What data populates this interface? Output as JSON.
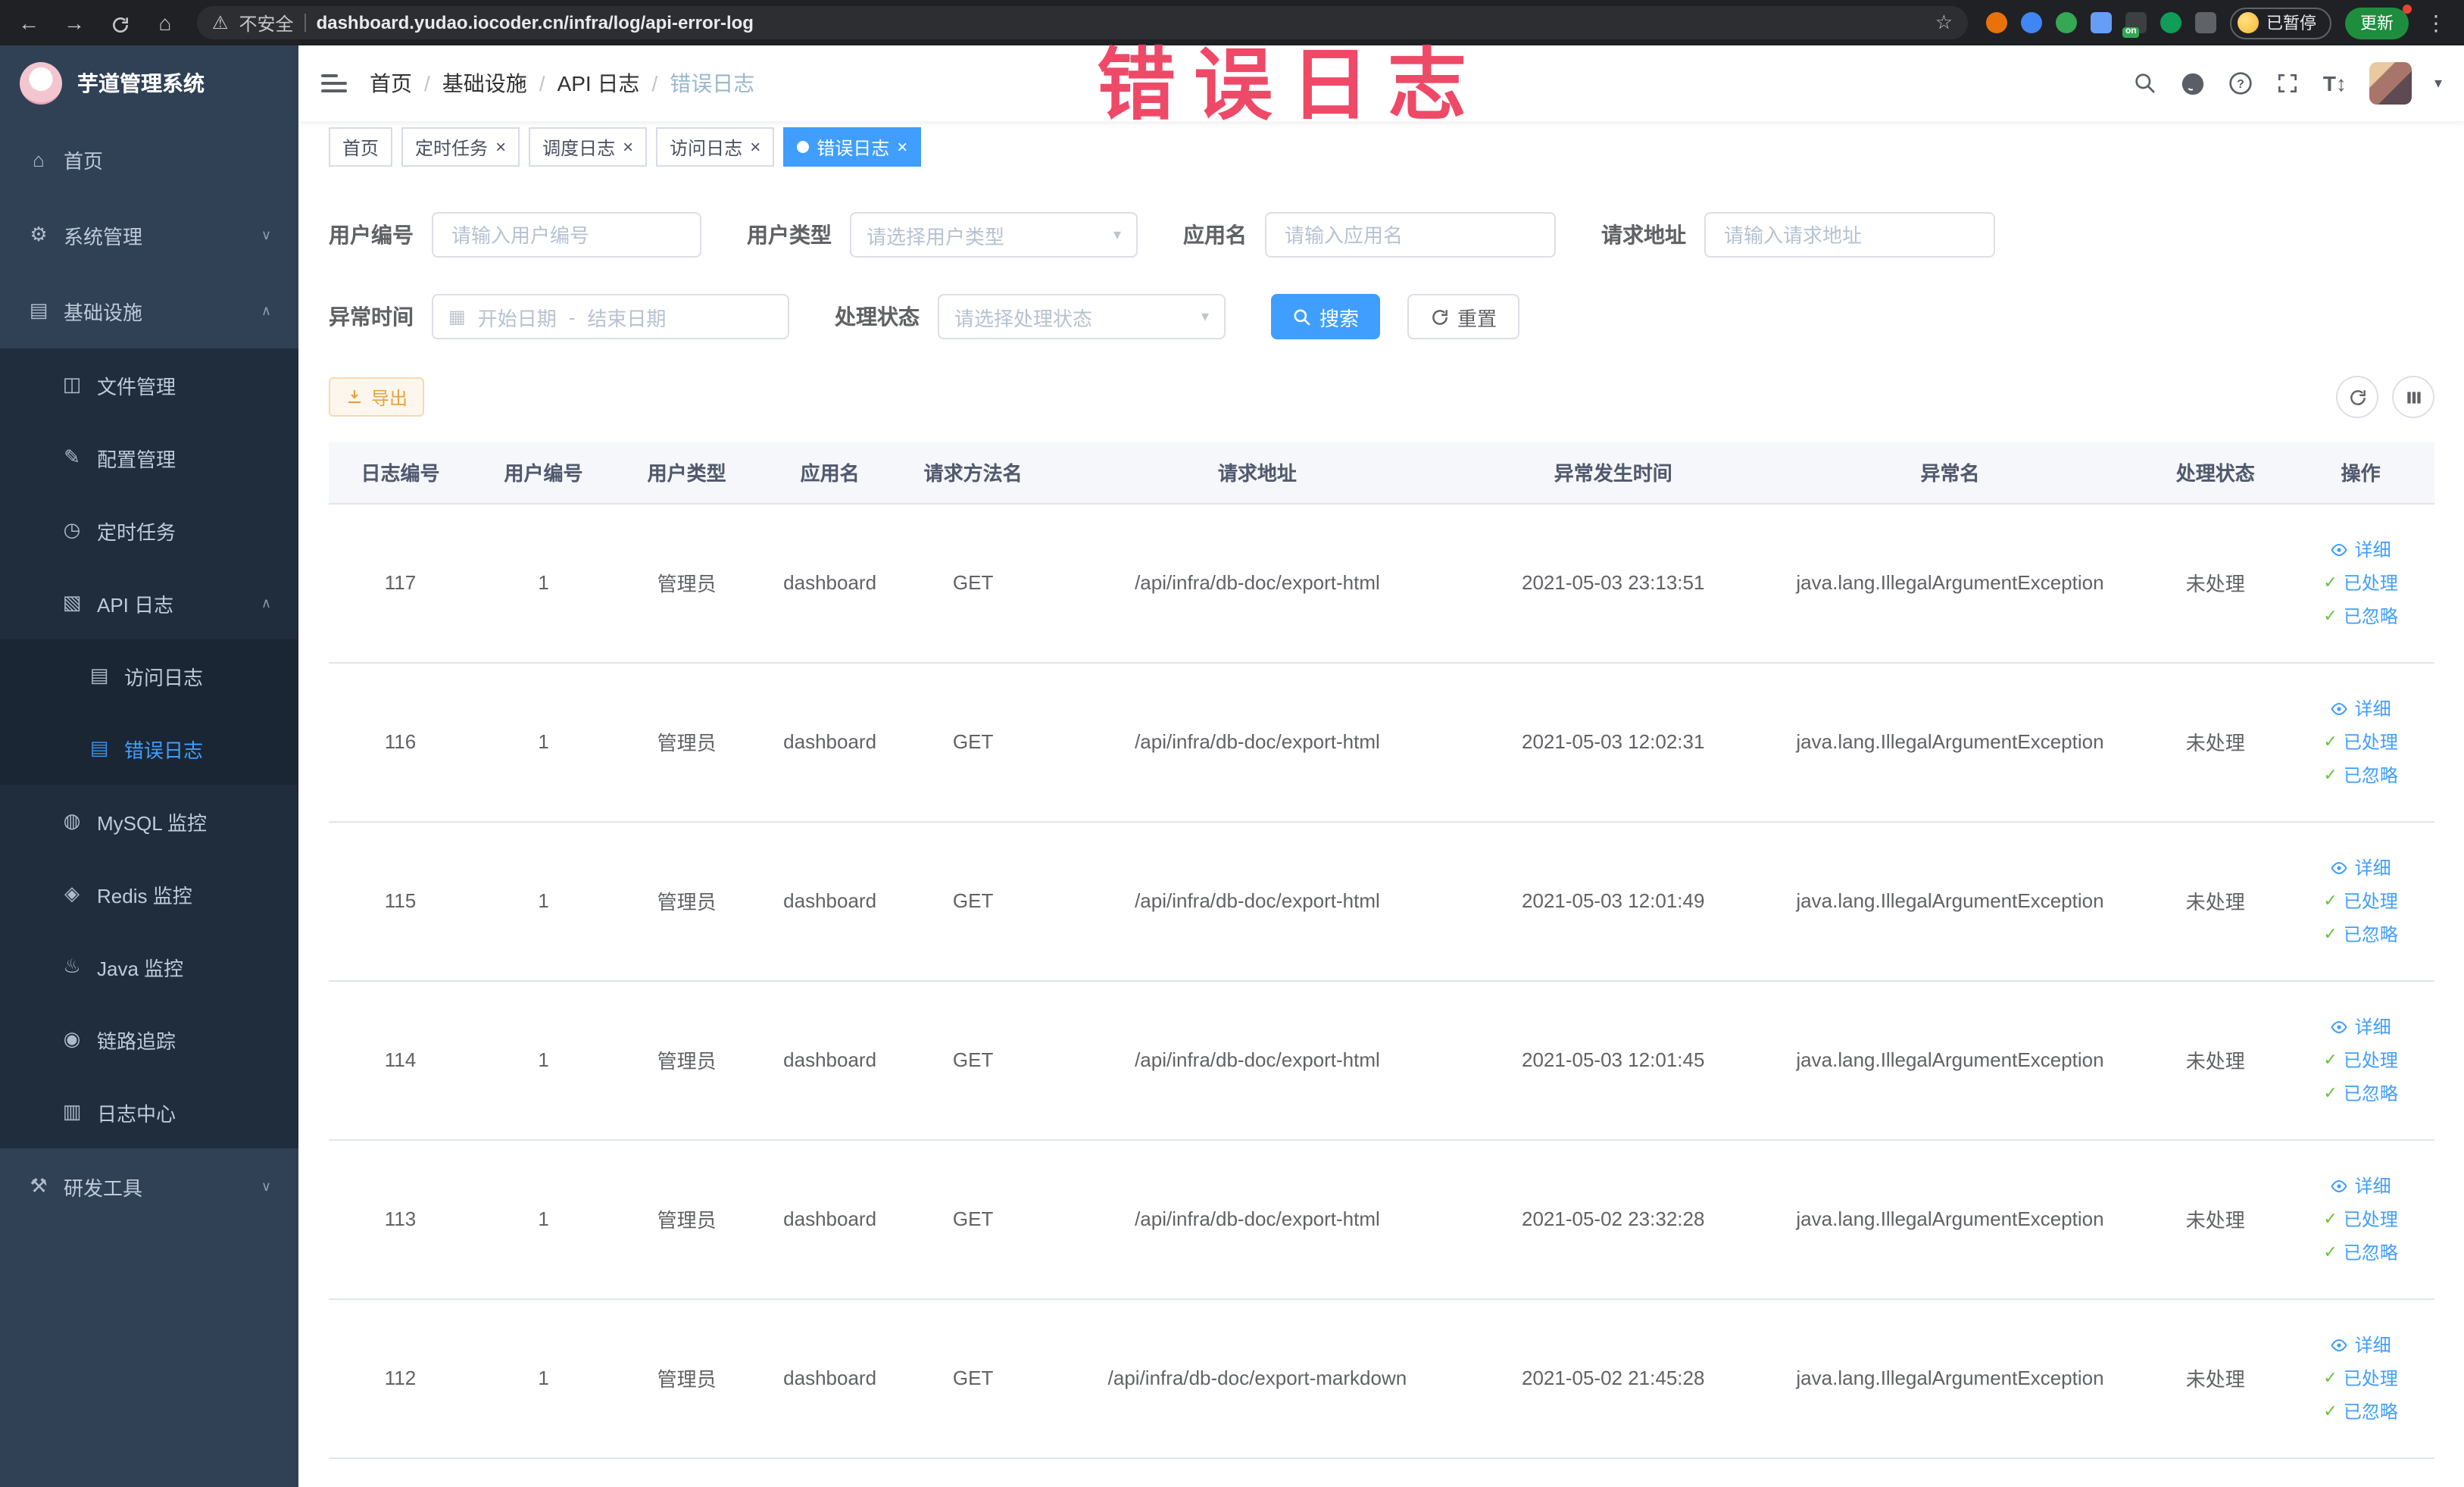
{
  "colors": {
    "accent": "#409eff",
    "success": "#67c23a",
    "warning": "#e6a23c",
    "sidebar_bg": "#304156",
    "submenu_bg": "#1f2d3d",
    "watermark": "#ee3a5c",
    "active_tab_bg": "#409eff"
  },
  "watermark_text": "错误日志",
  "icons": {
    "back": "←",
    "forward": "→",
    "home": "⌂",
    "warning": "⚠",
    "star": "☆",
    "overflow": "⋮",
    "close": "×",
    "chevron_down": "∨",
    "chevron_up": "∧",
    "caret_down": "▾",
    "check": "✓",
    "calendar": "▦",
    "menu_home": "⌂",
    "menu_system": "⚙",
    "menu_infra": "▤",
    "menu_file": "◫",
    "menu_config": "✎",
    "menu_job": "◷",
    "menu_apilog": "▧",
    "menu_doc": "▤",
    "menu_mysql": "◍",
    "menu_redis": "◈",
    "menu_java": "♨",
    "menu_trace": "◉",
    "menu_logcenter": "▥",
    "menu_tools": "⚒"
  },
  "browser": {
    "security_label": "不安全",
    "url": "dashboard.yudao.iocoder.cn/infra/log/api-error-log",
    "extension_badge": "on",
    "profile_chip": "已暂停",
    "update_button": "更新"
  },
  "sidebar": {
    "logo_title": "芋道管理系统",
    "items": [
      {
        "label": "首页"
      },
      {
        "label": "系统管理"
      },
      {
        "label": "基础设施"
      },
      {
        "label": "文件管理"
      },
      {
        "label": "配置管理"
      },
      {
        "label": "定时任务"
      },
      {
        "label": "API 日志"
      },
      {
        "label": "访问日志"
      },
      {
        "label": "错误日志"
      },
      {
        "label": "MySQL 监控"
      },
      {
        "label": "Redis 监控"
      },
      {
        "label": "Java 监控"
      },
      {
        "label": "链路追踪"
      },
      {
        "label": "日志中心"
      },
      {
        "label": "研发工具"
      }
    ]
  },
  "breadcrumb": {
    "separator": "/",
    "items": [
      "首页",
      "基础设施",
      "API 日志",
      "错误日志"
    ]
  },
  "tabs": [
    {
      "label": "首页"
    },
    {
      "label": "定时任务"
    },
    {
      "label": "调度日志"
    },
    {
      "label": "访问日志"
    },
    {
      "label": "错误日志"
    }
  ],
  "filters": {
    "user_id_label": "用户编号",
    "user_id_placeholder": "请输入用户编号",
    "user_type_label": "用户类型",
    "user_type_placeholder": "请选择用户类型",
    "app_name_label": "应用名",
    "app_name_placeholder": "请输入应用名",
    "request_url_label": "请求地址",
    "request_url_placeholder": "请输入请求地址",
    "exception_time_label": "异常时间",
    "date_start_placeholder": "开始日期",
    "date_separator": "-",
    "date_end_placeholder": "结束日期",
    "process_status_label": "处理状态",
    "process_status_placeholder": "请选择处理状态",
    "search_label": "搜索",
    "reset_label": "重置"
  },
  "toolbar": {
    "export_label": "导出"
  },
  "table": {
    "columns": [
      "日志编号",
      "用户编号",
      "用户类型",
      "应用名",
      "请求方法名",
      "请求地址",
      "异常发生时间",
      "异常名",
      "处理状态",
      "操作"
    ],
    "action_labels": {
      "detail": "详细",
      "processed": "已处理",
      "ignored": "已忽略"
    },
    "rows": [
      {
        "id": "117",
        "user_id": "1",
        "user_type": "管理员",
        "app_name": "dashboard",
        "method": "GET",
        "url": "/api/infra/db-doc/export-html",
        "time": "2021-05-03 23:13:51",
        "exception": "java.lang.IllegalArgumentException",
        "status": "未处理"
      },
      {
        "id": "116",
        "user_id": "1",
        "user_type": "管理员",
        "app_name": "dashboard",
        "method": "GET",
        "url": "/api/infra/db-doc/export-html",
        "time": "2021-05-03 12:02:31",
        "exception": "java.lang.IllegalArgumentException",
        "status": "未处理"
      },
      {
        "id": "115",
        "user_id": "1",
        "user_type": "管理员",
        "app_name": "dashboard",
        "method": "GET",
        "url": "/api/infra/db-doc/export-html",
        "time": "2021-05-03 12:01:49",
        "exception": "java.lang.IllegalArgumentException",
        "status": "未处理"
      },
      {
        "id": "114",
        "user_id": "1",
        "user_type": "管理员",
        "app_name": "dashboard",
        "method": "GET",
        "url": "/api/infra/db-doc/export-html",
        "time": "2021-05-03 12:01:45",
        "exception": "java.lang.IllegalArgumentException",
        "status": "未处理"
      },
      {
        "id": "113",
        "user_id": "1",
        "user_type": "管理员",
        "app_name": "dashboard",
        "method": "GET",
        "url": "/api/infra/db-doc/export-html",
        "time": "2021-05-02 23:32:28",
        "exception": "java.lang.IllegalArgumentException",
        "status": "未处理"
      },
      {
        "id": "112",
        "user_id": "1",
        "user_type": "管理员",
        "app_name": "dashboard",
        "method": "GET",
        "url": "/api/infra/db-doc/export-markdown",
        "time": "2021-05-02 21:45:28",
        "exception": "java.lang.IllegalArgumentException",
        "status": "未处理"
      }
    ]
  }
}
